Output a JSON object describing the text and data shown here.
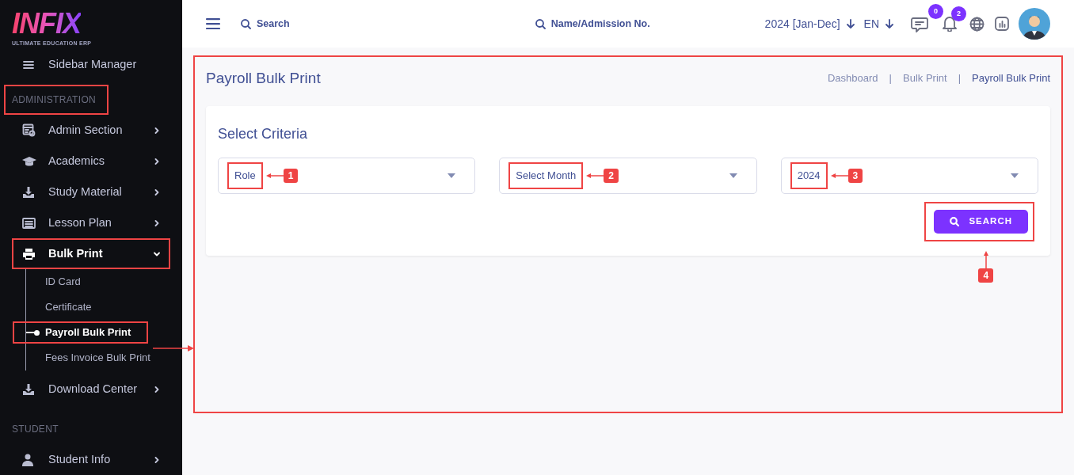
{
  "logo": {
    "text": "INFIX",
    "tagline": "ULTIMATE EDUCATION ERP"
  },
  "header": {
    "search_placeholder": "Search",
    "student_search_placeholder": "Name/Admission No.",
    "session": "2024 [Jan-Dec]",
    "language": "EN",
    "messages_count": "0",
    "notifications_count": "2"
  },
  "sidebar": {
    "items": [
      {
        "kind": "item",
        "label": "Sidebar Manager",
        "selected": false,
        "annotated": false
      },
      {
        "kind": "section",
        "label": "ADMINISTRATION",
        "annotated": true
      },
      {
        "kind": "item",
        "label": "Admin Section",
        "selected": false,
        "expanded": false,
        "annotated": false
      },
      {
        "kind": "item",
        "label": "Academics",
        "selected": false,
        "expanded": false,
        "annotated": false
      },
      {
        "kind": "item",
        "label": "Study Material",
        "selected": false,
        "expanded": false,
        "annotated": false
      },
      {
        "kind": "item",
        "label": "Lesson Plan",
        "selected": false,
        "expanded": false,
        "annotated": false
      },
      {
        "kind": "item",
        "label": "Bulk Print",
        "selected": true,
        "expanded": true,
        "annotated": true,
        "children": [
          {
            "label": "ID Card",
            "selected": false,
            "annotated": false
          },
          {
            "label": "Certificate",
            "selected": false,
            "annotated": false
          },
          {
            "label": "Payroll Bulk Print",
            "selected": true,
            "annotated": true
          },
          {
            "label": "Fees Invoice Bulk Print",
            "selected": false,
            "annotated": false
          }
        ]
      },
      {
        "kind": "item",
        "label": "Download Center",
        "selected": false,
        "expanded": false,
        "annotated": false
      },
      {
        "kind": "section",
        "label": "STUDENT",
        "annotated": false
      },
      {
        "kind": "item",
        "label": "Student Info",
        "selected": false,
        "expanded": false,
        "annotated": false
      }
    ]
  },
  "page": {
    "title": "Payroll Bulk Print",
    "breadcrumbs": [
      {
        "kind": "link",
        "label": "Dashboard",
        "selected": false
      },
      {
        "kind": "separator",
        "label": "|"
      },
      {
        "kind": "link",
        "label": "Bulk Print",
        "selected": false
      },
      {
        "kind": "separator",
        "label": "|"
      },
      {
        "kind": "link",
        "label": "Payroll Bulk Print",
        "selected": true
      }
    ]
  },
  "criteria": {
    "title": "Select Criteria",
    "fields": [
      {
        "value": "Role",
        "callout": "1"
      },
      {
        "value": "Select Month",
        "callout": "2"
      },
      {
        "value": "2024",
        "callout": "3"
      }
    ],
    "button": {
      "label": "SEARCH",
      "callout": "4"
    }
  }
}
